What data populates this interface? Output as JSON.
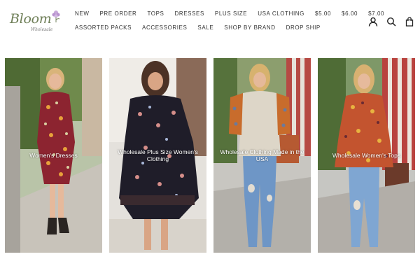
{
  "brand": {
    "name": "Bloom",
    "tagline": "Wholesale"
  },
  "nav": {
    "row1": [
      "NEW",
      "PRE ORDER",
      "TOPS",
      "DRESSES",
      "PLUS SIZE",
      "USA CLOTHING",
      "$5.00",
      "$6.00",
      "$7.00"
    ],
    "row2": [
      "ASSORTED PACKS",
      "ACCESSORIES",
      "SALE",
      "SHOP BY BRAND",
      "DROP SHIP"
    ]
  },
  "header_icons": [
    "account-icon",
    "search-icon",
    "cart-icon"
  ],
  "collections": [
    {
      "caption": "Women's Dresses"
    },
    {
      "caption": "Wholesale Plus Size Women's Clothing"
    },
    {
      "caption": "Wholesale Clothing Made in the USA"
    },
    {
      "caption": "Wholesale Women's Tops"
    }
  ],
  "colors": {
    "logo_green": "#6f7f58",
    "logo_flower": "#c7a7d9",
    "nav_text": "#333333"
  }
}
